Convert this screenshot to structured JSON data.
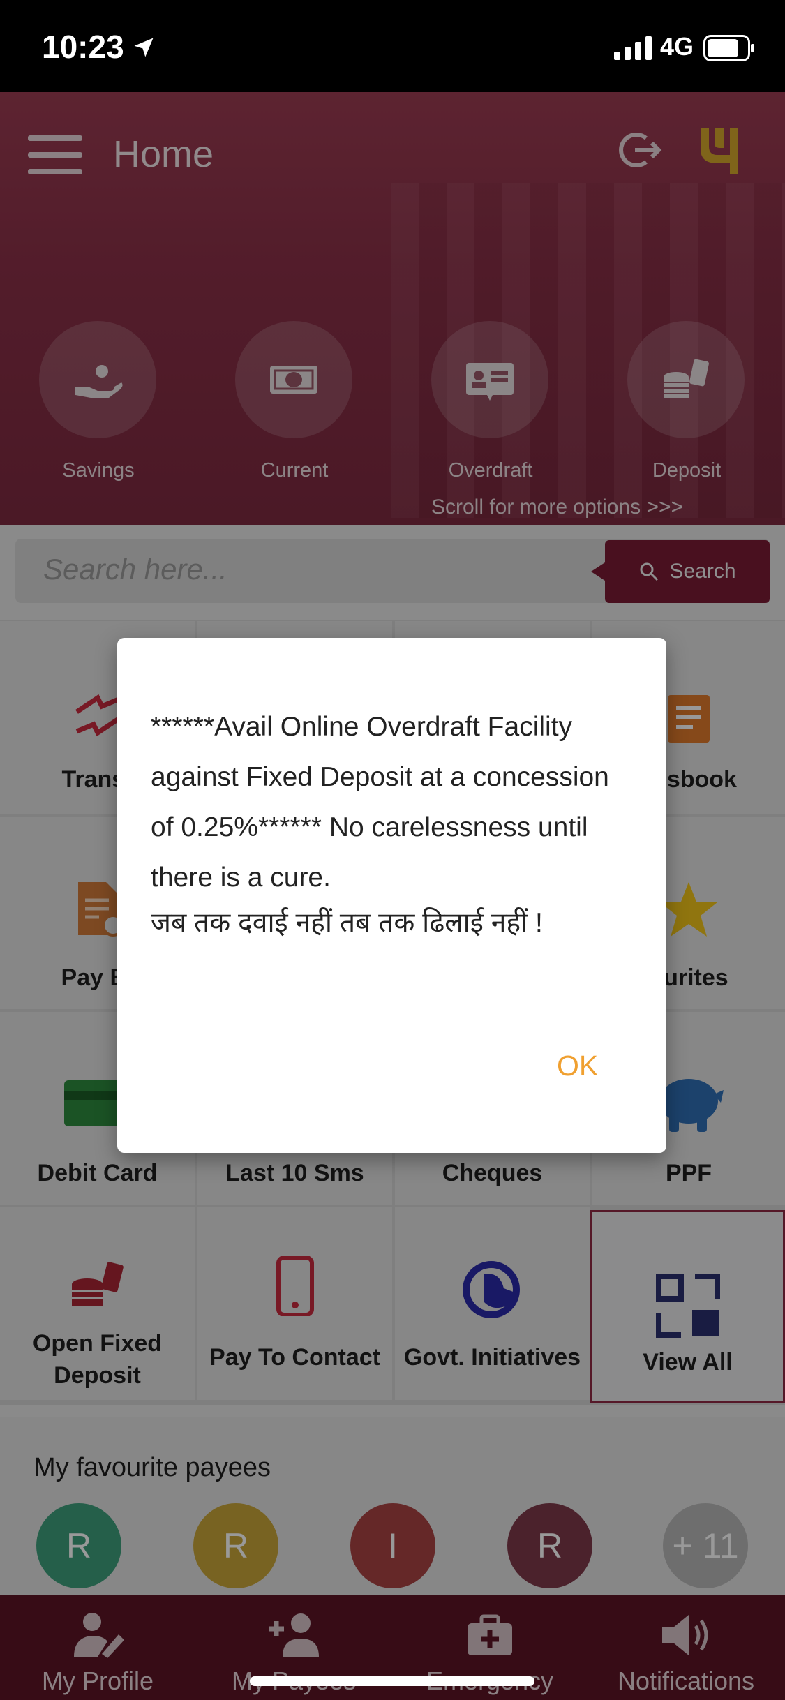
{
  "status_bar": {
    "time": "10:23",
    "network": "4G"
  },
  "header": {
    "title": "Home",
    "scroll_hint": "Scroll for more options >>>"
  },
  "accounts": [
    {
      "label": "Savings",
      "icon": "hand-coin-icon"
    },
    {
      "label": "Current",
      "icon": "banknote-icon"
    },
    {
      "label": "Overdraft",
      "icon": "id-card-icon"
    },
    {
      "label": "Deposit",
      "icon": "coin-stack-icon"
    }
  ],
  "search": {
    "placeholder": "Search here...",
    "button_label": "Search"
  },
  "grid": {
    "row1": [
      "Transfer",
      "",
      "",
      "Passbook"
    ],
    "row1_visible": {
      "left": "Transf",
      "right": "assbook"
    },
    "row2_visible": {
      "left": "Pay Bi",
      "right": "ourites"
    },
    "row3": [
      "Debit Card",
      "Last 10 Sms",
      "Cheques",
      "PPF"
    ],
    "row4": {
      "open_fd_line1": "Open Fixed",
      "open_fd_line2": "Deposit",
      "pay_contact": "Pay To Contact",
      "govt": "Govt. Initiatives",
      "view_all": "View All"
    }
  },
  "favourites": {
    "title": "My favourite payees",
    "avatars": [
      {
        "letter": "R",
        "color": "#3f9e7c"
      },
      {
        "letter": "R",
        "color": "#c9a53a"
      },
      {
        "letter": "I",
        "color": "#a84444"
      },
      {
        "letter": "R",
        "color": "#7e3a4a"
      },
      {
        "letter": "+ 11",
        "color": "#b8b8b8"
      }
    ]
  },
  "bottom_nav": {
    "profile": "My Profile",
    "payees": "My Payees",
    "emergency": "Emergency",
    "notifications": "Notifications"
  },
  "dialog": {
    "message": "******Avail Online Overdraft Facility against Fixed Deposit at a concession of 0.25%****** No carelessness until there is a cure.",
    "hindi": "जब तक दवाई नहीं तब तक ढिलाई नहीं !",
    "ok_label": "OK"
  },
  "colors": {
    "brand": "#7a1c34",
    "accent": "#f0a030",
    "logo": "#d4a72c"
  }
}
